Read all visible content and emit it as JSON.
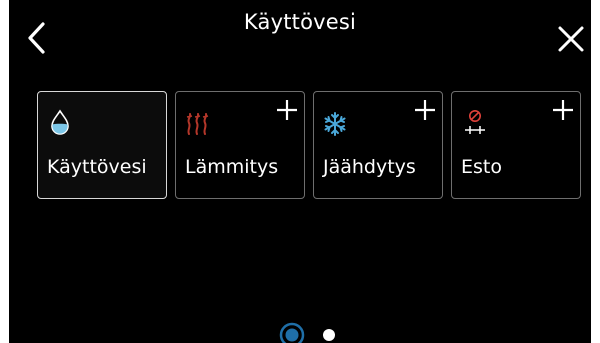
{
  "header": {
    "title": "Käyttövesi",
    "back_icon": "chevron-left-icon",
    "close_icon": "close-icon"
  },
  "tiles": [
    {
      "label": "Käyttövesi",
      "icon": "water-drop-icon",
      "selected": true,
      "has_add": false
    },
    {
      "label": "Lämmitys",
      "icon": "heating-waves-icon",
      "selected": false,
      "has_add": true
    },
    {
      "label": "Jäähdytys",
      "icon": "snowflake-icon",
      "selected": false,
      "has_add": true
    },
    {
      "label": "Esto",
      "icon": "block-icon",
      "selected": false,
      "has_add": true
    }
  ],
  "pagination": {
    "current_page": 1,
    "total_pages": 2
  },
  "colors": {
    "background": "#000000",
    "text": "#ffffff",
    "selected_border": "#d8d8d8",
    "tile_border": "#6e6e6e",
    "water_blue": "#7cc7e8",
    "heating_red": "#b5372a",
    "snow_blue": "#4aa7d8",
    "block_red": "#e0413a",
    "active_dot": "#1f6fa8"
  }
}
